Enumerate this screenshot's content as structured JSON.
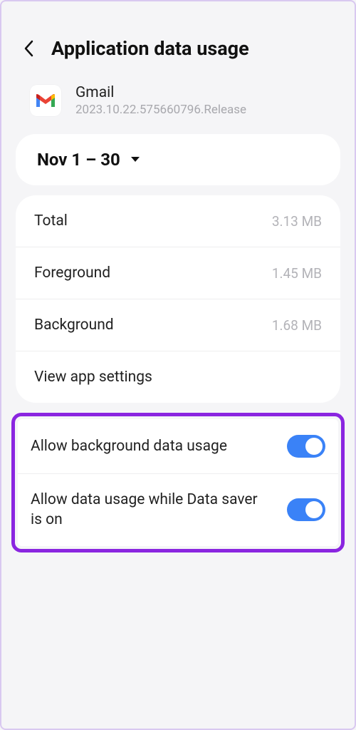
{
  "header": {
    "title": "Application data usage"
  },
  "app": {
    "name": "Gmail",
    "version": "2023.10.22.575660796.Release"
  },
  "period": {
    "label": "Nov 1 – 30"
  },
  "stats": {
    "total_label": "Total",
    "total_value": "3.13 MB",
    "foreground_label": "Foreground",
    "foreground_value": "1.45 MB",
    "background_label": "Background",
    "background_value": "1.68 MB",
    "view_settings_label": "View app settings"
  },
  "toggles": {
    "bg_data_label": "Allow background data usage",
    "bg_data_on": true,
    "data_saver_label": "Allow data usage while Data saver is on",
    "data_saver_on": true
  }
}
